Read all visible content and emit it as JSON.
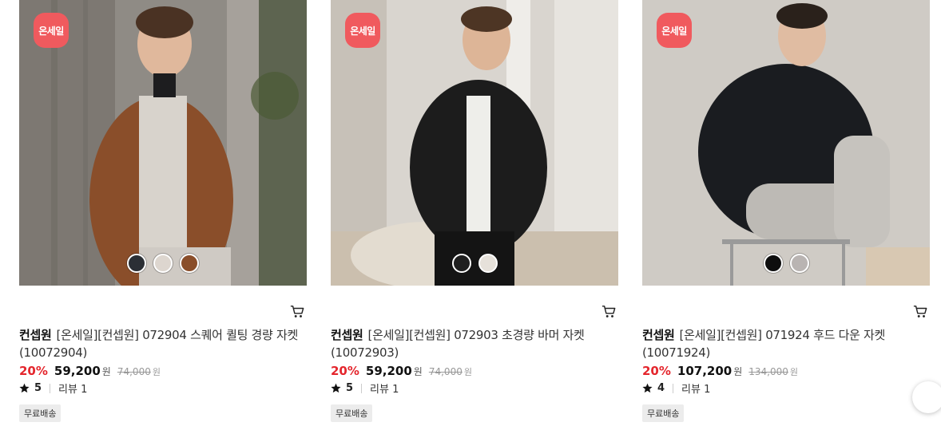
{
  "products": [
    {
      "badge": "온세일",
      "brand": "컨셉원",
      "name": "[온세일][컨셉원] 072904 스퀘어 퀼팅 경량 자켓 (10072904)",
      "discount": "20%",
      "price": "59,200",
      "price_unit": "원",
      "original_price": "74,000",
      "original_unit": "원",
      "rating": "5",
      "reviews": "리뷰 1",
      "shipping": "무료배송",
      "swatches": [
        "#2b2f35",
        "#ddd6cf",
        "#8a4e2a"
      ]
    },
    {
      "badge": "온세일",
      "brand": "컨셉원",
      "name": "[온세일][컨셉원] 072903 초경량 바머 자켓 (10072903)",
      "discount": "20%",
      "price": "59,200",
      "price_unit": "원",
      "original_price": "74,000",
      "original_unit": "원",
      "rating": "5",
      "reviews": "리뷰 1",
      "shipping": "무료배송",
      "swatches": [
        "#1f1f1f",
        "#e6e1da"
      ]
    },
    {
      "badge": "온세일",
      "brand": "컨셉원",
      "name": "[온세일][컨셉원] 071924 후드 다운 자켓 (10071924)",
      "discount": "20%",
      "price": "107,200",
      "price_unit": "원",
      "original_price": "134,000",
      "original_unit": "원",
      "rating": "4",
      "reviews": "리뷰 1",
      "shipping": "무료배송",
      "swatches": [
        "#0e0e0e",
        "#b9b4b2"
      ]
    }
  ],
  "icons": {
    "cart": "cart-icon",
    "star": "star-icon"
  },
  "colors": {
    "badge": "#f05a5e",
    "discount": "#e4262d",
    "shipping_bg": "#ececec"
  }
}
